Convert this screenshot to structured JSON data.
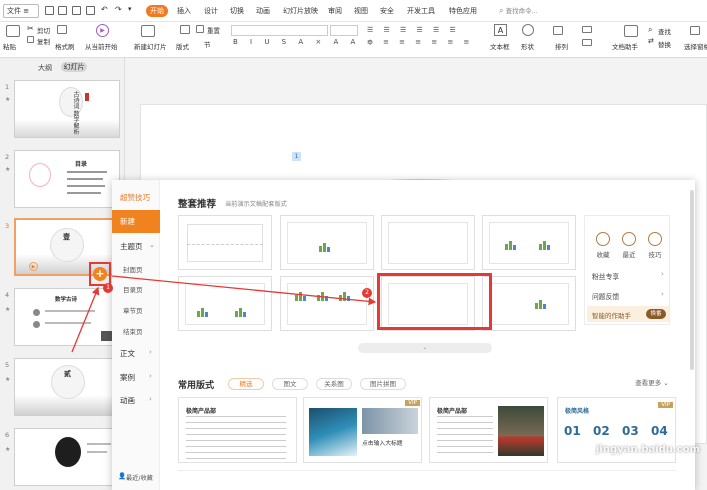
{
  "menubar": {
    "file": "文件",
    "tabs": [
      "开始",
      "插入",
      "设计",
      "切换",
      "动画",
      "幻灯片放映",
      "审阅",
      "视图",
      "安全",
      "开发工具",
      "特色应用"
    ],
    "search": "查找命令..."
  },
  "ribbon": {
    "paste": "粘贴",
    "cut": "剪切",
    "copy": "复制",
    "format_painter": "格式刷",
    "from_current": "从当前开始",
    "new_slide": "新建幻灯片",
    "layout": "版式",
    "section": "节",
    "reset": "重置",
    "textbox": "文本框",
    "shape": "形状",
    "arrange": "排列",
    "doc_assistant": "文档助手",
    "find": "查找",
    "replace": "替换",
    "select_pane": "选择窗格"
  },
  "leftpanel": {
    "tab_outline": "大纲",
    "tab_slides": "幻灯片",
    "slide_numbers": [
      "1",
      "2",
      "3",
      "4",
      "5",
      "6"
    ],
    "thumb1_title": "古诗词 数学解析",
    "thumb2_title": "目录",
    "thumb3_title": "壹",
    "thumb4_title": "数学古诗",
    "thumb5_title": "贰"
  },
  "canvas": {
    "marker": "1"
  },
  "dialog": {
    "nav": {
      "tips": "超赞技巧",
      "new": "新建",
      "theme": "主题页",
      "cover": "封面页",
      "toc": "目录页",
      "chapter": "章节页",
      "ending": "结束页",
      "body": "正文",
      "case": "案例",
      "animation": "动画",
      "recent": "最近/收藏"
    },
    "section_title": "整套推荐",
    "section_sub": "当前演示文稿配套版式",
    "side": {
      "favorite": "收藏",
      "recent": "最近",
      "tips": "技巧",
      "fans": "粉丝专享",
      "feedback": "问题反馈",
      "assistant": "智能的作助手",
      "assistant_badge": "换番"
    },
    "common_title": "常用版式",
    "filters": [
      "精选",
      "图文",
      "关系图",
      "图片拼图"
    ],
    "view_more": "查看更多",
    "templates": {
      "t1_title": "极简产品部",
      "t2_title": "点击输入大标题",
      "t3_title": "极简产品部",
      "t5_title": "极简风格",
      "vip": "VIP",
      "vip2": "VIP",
      "digits": [
        "01",
        "02",
        "03",
        "04"
      ]
    }
  },
  "annotations": {
    "plus": "+",
    "step1": "1",
    "step2": "2"
  },
  "watermark": "jingyan.baidu.com",
  "colors": {
    "accent": "#f0821f",
    "highlight_red": "#e53935",
    "slide_blue": "#4f86c6"
  }
}
